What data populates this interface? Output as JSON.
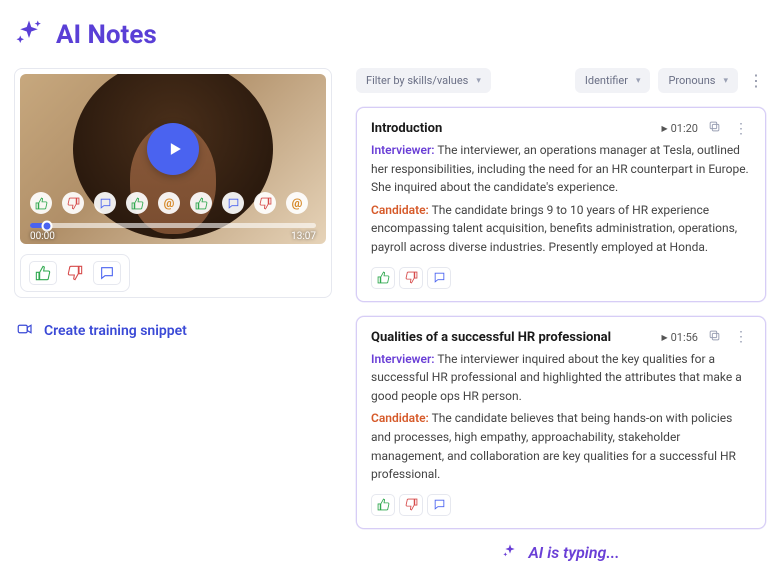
{
  "header": {
    "title": "AI Notes"
  },
  "video": {
    "current_time": "00:00",
    "duration": "13:07"
  },
  "snippet_label": "Create training snippet",
  "filters": {
    "skills": "Filter by skills/values",
    "identifier": "Identifier",
    "pronouns": "Pronouns"
  },
  "labels": {
    "interviewer": "Interviewer:",
    "candidate": "Candidate:"
  },
  "notes": [
    {
      "title": "Introduction",
      "timestamp": "01:20",
      "interviewer_text": "The interviewer, an operations manager at Tesla, outlined her responsibilities, including the need for an HR counterpart in Europe. She inquired about the candidate's experience.",
      "candidate_text": "The candidate brings 9 to 10 years of HR experience encompassing talent acquisition, benefits administration, operations, payroll across diverse industries. Presently employed at Honda."
    },
    {
      "title": "Qualities of a successful HR professional",
      "timestamp": "01:56",
      "interviewer_text": "The interviewer inquired about the key qualities for a successful HR professional and highlighted the attributes that make a good people ops HR person.",
      "candidate_text": "The candidate believes that being hands-on with policies and processes, high empathy, approachability, stakeholder management, and collaboration are key qualities for a successful HR professional."
    }
  ],
  "typing_label": "AI is typing..."
}
